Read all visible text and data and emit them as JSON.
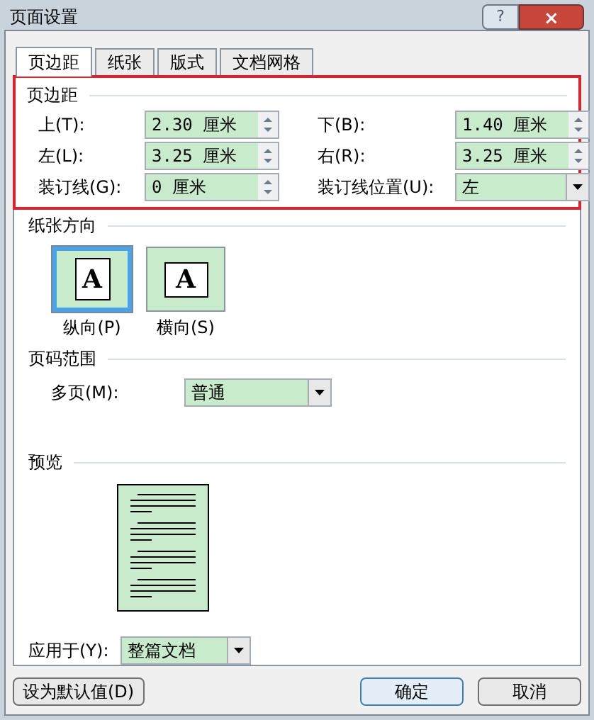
{
  "window": {
    "title": "页面设置",
    "help": "?",
    "close": "×"
  },
  "tabs": [
    {
      "label": "页边距",
      "selected": true
    },
    {
      "label": "纸张",
      "selected": false
    },
    {
      "label": "版式",
      "selected": false
    },
    {
      "label": "文档网格",
      "selected": false
    }
  ],
  "margins": {
    "heading": "页边距",
    "fields": [
      {
        "label": "上(T):",
        "value": "2.30 厘米",
        "kind": "spin"
      },
      {
        "label": "下(B):",
        "value": "1.40 厘米",
        "kind": "spin"
      },
      {
        "label": "左(L):",
        "value": "3.25 厘米",
        "kind": "spin"
      },
      {
        "label": "右(R):",
        "value": "3.25 厘米",
        "kind": "spin"
      },
      {
        "label": "装订线(G):",
        "value": "0 厘米",
        "kind": "spin"
      },
      {
        "label": "装订线位置(U):",
        "value": "左",
        "kind": "select"
      }
    ]
  },
  "orientation": {
    "heading": "纸张方向",
    "options": [
      {
        "label": "纵向(P)",
        "glyph": "A",
        "selected": true
      },
      {
        "label": "横向(S)",
        "glyph": "A",
        "selected": false
      }
    ]
  },
  "pages": {
    "heading": "页码范围",
    "label": "多页(M):",
    "value": "普通"
  },
  "preview": {
    "heading": "预览"
  },
  "apply": {
    "label": "应用于(Y):",
    "value": "整篇文档"
  },
  "buttons": {
    "default": "设为默认值(D)",
    "ok": "确定",
    "cancel": "取消"
  }
}
